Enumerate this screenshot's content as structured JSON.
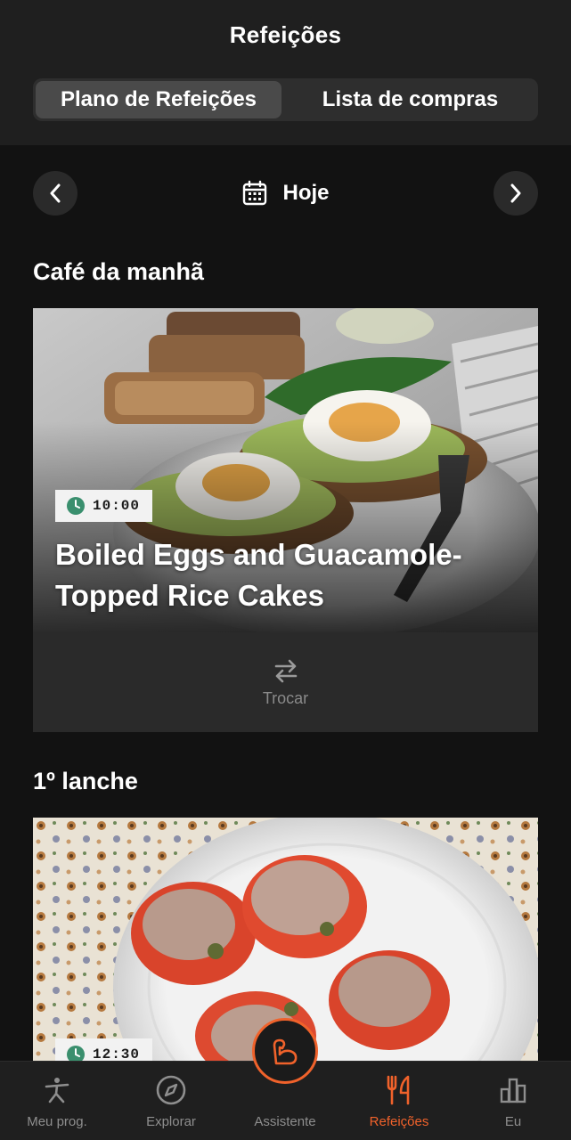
{
  "header": {
    "title": "Refeições",
    "tabs": [
      {
        "label": "Plano de Refeições",
        "active": true
      },
      {
        "label": "Lista de compras",
        "active": false
      }
    ]
  },
  "date_nav": {
    "label": "Hoje",
    "prev_icon": "chevron-left-icon",
    "next_icon": "chevron-right-icon",
    "calendar_icon": "calendar-icon"
  },
  "meals": [
    {
      "section": "Café da manhã",
      "time": "10:00",
      "title": "Boiled Eggs and Guacamole-Topped Rice Cakes",
      "swap_label": "Trocar"
    },
    {
      "section": "1º lanche",
      "time": "12:30"
    }
  ],
  "tabbar": {
    "items": [
      {
        "label": "Meu prog.",
        "icon": "exercise-person-icon"
      },
      {
        "label": "Explorar",
        "icon": "compass-icon"
      },
      {
        "label": "Assistente",
        "icon": "flexed-arm-icon"
      },
      {
        "label": "Refeições",
        "icon": "fork-knife-icon",
        "active": true
      },
      {
        "label": "Eu",
        "icon": "bar-chart-icon"
      }
    ]
  },
  "colors": {
    "accent": "#f0622b",
    "background": "#121212",
    "header": "#1f1f1f",
    "clock_green": "#3a8f6e"
  }
}
